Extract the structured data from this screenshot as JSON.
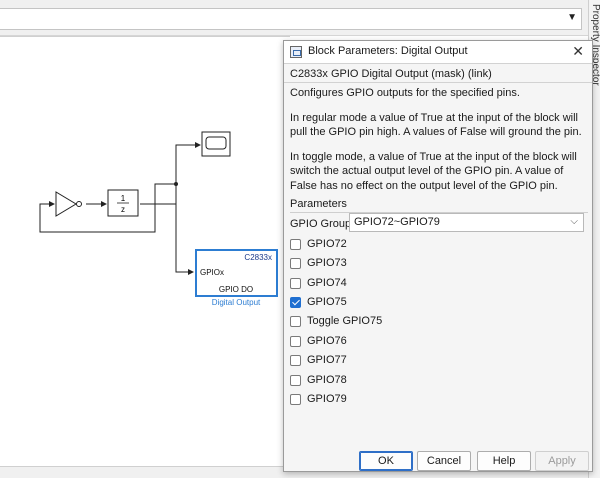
{
  "inspector_label": "Property Inspector",
  "diagram": {
    "gain_label": "1",
    "delay_num": "1",
    "delay_den": "z",
    "do_block": {
      "target": "C2833x",
      "port": "GPIOx",
      "inner": "GPIO DO",
      "name": "Digital Output"
    }
  },
  "dialog": {
    "title": "Block Parameters: Digital Output",
    "close_glyph": "✕",
    "subtitle": "C2833x GPIO Digital Output (mask) (link)",
    "desc_1": "Configures GPIO outputs for the specified pins.",
    "desc_2": "In regular mode a value of True at the input of the block will pull the GPIO pin high. A values of False will ground the pin.",
    "desc_3": "In toggle mode, a value of True at the input of the block will switch the actual output level of the GPIO pin. A value of False has no effect on the output level of the GPIO pin.",
    "params_heading": "Parameters",
    "group_label": "GPIO Group:",
    "group_value": "GPIO72~GPIO79",
    "checkboxes": [
      {
        "label": "GPIO72",
        "checked": false
      },
      {
        "label": "GPIO73",
        "checked": false
      },
      {
        "label": "GPIO74",
        "checked": false
      },
      {
        "label": "GPIO75",
        "checked": true
      },
      {
        "label": "Toggle GPIO75",
        "checked": false
      },
      {
        "label": "GPIO76",
        "checked": false
      },
      {
        "label": "GPIO77",
        "checked": false
      },
      {
        "label": "GPIO78",
        "checked": false
      },
      {
        "label": "GPIO79",
        "checked": false
      }
    ],
    "buttons": {
      "ok": "OK",
      "cancel": "Cancel",
      "help": "Help",
      "apply": "Apply"
    }
  }
}
